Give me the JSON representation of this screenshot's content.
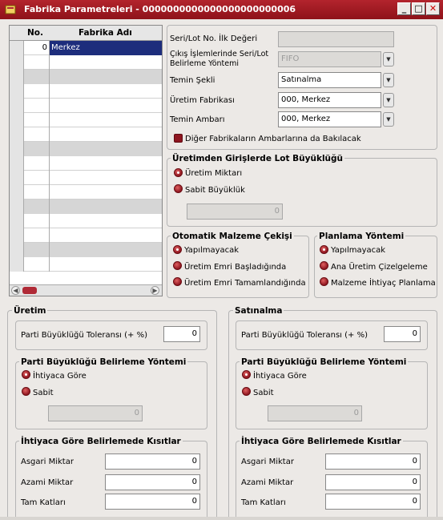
{
  "window": {
    "title": "Fabrika Parametreleri - 0000000000000000000000006",
    "min_glyph": "_",
    "max_glyph": "□",
    "close_glyph": "✕"
  },
  "grid": {
    "columns": [
      "No.",
      "Fabrika Adı"
    ],
    "rows": [
      {
        "no": "0",
        "name": "Merkez"
      }
    ]
  },
  "top_form": {
    "seri_lot_ilk_label": "Seri/Lot No. İlk Değeri",
    "seri_lot_ilk_value": "",
    "cikis_label_line1": "Çıkış İşlemlerinde Seri/Lot",
    "cikis_label_line2": "Belirleme Yöntemi",
    "cikis_value": "FIFO",
    "temin_sekli_label": "Temin Şekli",
    "temin_sekli_value": "Satınalma",
    "uretim_fabrikasi_label": "Üretim Fabrikası",
    "uretim_fabrikasi_value": "000, Merkez",
    "temin_ambari_label": "Temin Ambarı",
    "temin_ambari_value": "000, Merkez",
    "diger_check_label": "Diğer Fabrikaların Ambarlarına da Bakılacak"
  },
  "lot_group": {
    "title": "Üretimden Girişlerde Lot Büyüklüğü",
    "option1": "Üretim Miktarı",
    "option2": "Sabit Büyüklük",
    "value": "0"
  },
  "otomatik_group": {
    "title": "Otomatik Malzeme Çekişi",
    "option1": "Yapılmayacak",
    "option2": "Üretim Emri Başladığında",
    "option3": "Üretim Emri Tamamlandığında"
  },
  "planlama_group": {
    "title": "Planlama Yöntemi",
    "option1": "Yapılmayacak",
    "option2": "Ana Üretim Çizelgeleme",
    "option3": "Malzeme İhtiyaç Planlama"
  },
  "uretim": {
    "title": "Üretim",
    "tolerans_label": "Parti Büyüklüğü Toleransı (+ %)",
    "tolerans_value": "0",
    "yontem_title": "Parti Büyüklüğü Belirleme Yöntemi",
    "yontem_option1": "İhtiyaca Göre",
    "yontem_option2": "Sabit",
    "sabit_value": "0",
    "kisit_title": "İhtiyaca Göre Belirlemede Kısıtlar",
    "asgari_label": "Asgari Miktar",
    "asgari_value": "0",
    "azami_label": "Azami Miktar",
    "azami_value": "0",
    "tam_label": "Tam Katları",
    "tam_value": "0"
  },
  "satinalma": {
    "title": "Satınalma",
    "tolerans_label": "Parti Büyüklüğü Toleransı (+ %)",
    "tolerans_value": "0",
    "yontem_title": "Parti Büyüklüğü Belirleme Yöntemi",
    "yontem_option1": "İhtiyaca Göre",
    "yontem_option2": "Sabit",
    "sabit_value": "0",
    "kisit_title": "İhtiyaca Göre Belirlemede Kısıtlar",
    "asgari_label": "Asgari Miktar",
    "asgari_value": "0",
    "azami_label": "Azami Miktar",
    "azami_value": "0",
    "tam_label": "Tam Katları",
    "tam_value": "0"
  },
  "colors": {
    "title_bar": "#a01c25",
    "selection": "#1d2d7c",
    "radio": "#8e1620"
  }
}
